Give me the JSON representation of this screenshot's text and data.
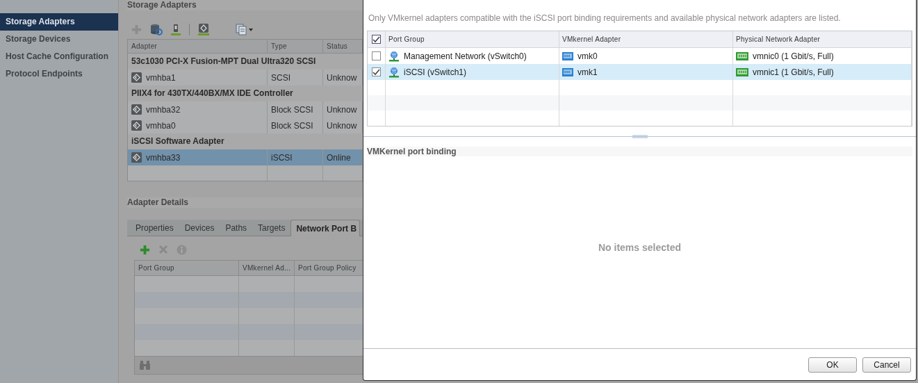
{
  "sidebar": {
    "items": [
      {
        "label": "Storage Adapters",
        "selected": true
      },
      {
        "label": "Storage Devices",
        "selected": false
      },
      {
        "label": "Host Cache Configuration",
        "selected": false
      },
      {
        "label": "Protocol Endpoints",
        "selected": false
      }
    ]
  },
  "adapters": {
    "title": "Storage Adapters",
    "columns": [
      "Adapter",
      "Type",
      "Status"
    ],
    "groups": [
      {
        "name": "53c1030 PCI-X Fusion-MPT Dual Ultra320 SCSI",
        "rows": [
          {
            "adapter": "vmhba1",
            "type": "SCSI",
            "status": "Unknow",
            "selected": false
          }
        ]
      },
      {
        "name": "PIIX4 for 430TX/440BX/MX IDE Controller",
        "rows": [
          {
            "adapter": "vmhba32",
            "type": "Block SCSI",
            "status": "Unknow",
            "selected": false
          },
          {
            "adapter": "vmhba0",
            "type": "Block SCSI",
            "status": "Unknow",
            "selected": false
          }
        ]
      },
      {
        "name": "iSCSI Software Adapter",
        "rows": [
          {
            "adapter": "vmhba33",
            "type": "iSCSI",
            "status": "Online",
            "selected": true
          }
        ]
      }
    ]
  },
  "adapter_details": {
    "title": "Adapter Details",
    "tabs": [
      {
        "label": "Properties",
        "selected": false
      },
      {
        "label": "Devices",
        "selected": false
      },
      {
        "label": "Paths",
        "selected": false
      },
      {
        "label": "Targets",
        "selected": false
      },
      {
        "label": "Network Port B",
        "selected": true
      }
    ],
    "columns": [
      "Port Group",
      "VMkernel Ad...",
      "Port Group Policy"
    ]
  },
  "dialog": {
    "description": "Only VMkernel adapters compatible with the iSCSI port binding requirements and available physical network adapters are listed.",
    "columns": [
      "Port Group",
      "VMkernel Adapter",
      "Physical Network Adapter"
    ],
    "all_checked": true,
    "rows": [
      {
        "port_group": "Management Network (vSwitch0)",
        "vmkernel_adapter": "vmk0",
        "physical_adapter": "vmnic0 (1 Gbit/s, Full)",
        "checked": false,
        "selected": false
      },
      {
        "port_group": "iSCSI (vSwitch1)",
        "vmkernel_adapter": "vmk1",
        "physical_adapter": "vmnic1 (1 Gbit/s, Full)",
        "checked": true,
        "selected": true
      }
    ],
    "binding_title": "VMKernel port binding",
    "empty_message": "No items selected",
    "buttons": [
      "OK",
      "Cancel"
    ]
  }
}
